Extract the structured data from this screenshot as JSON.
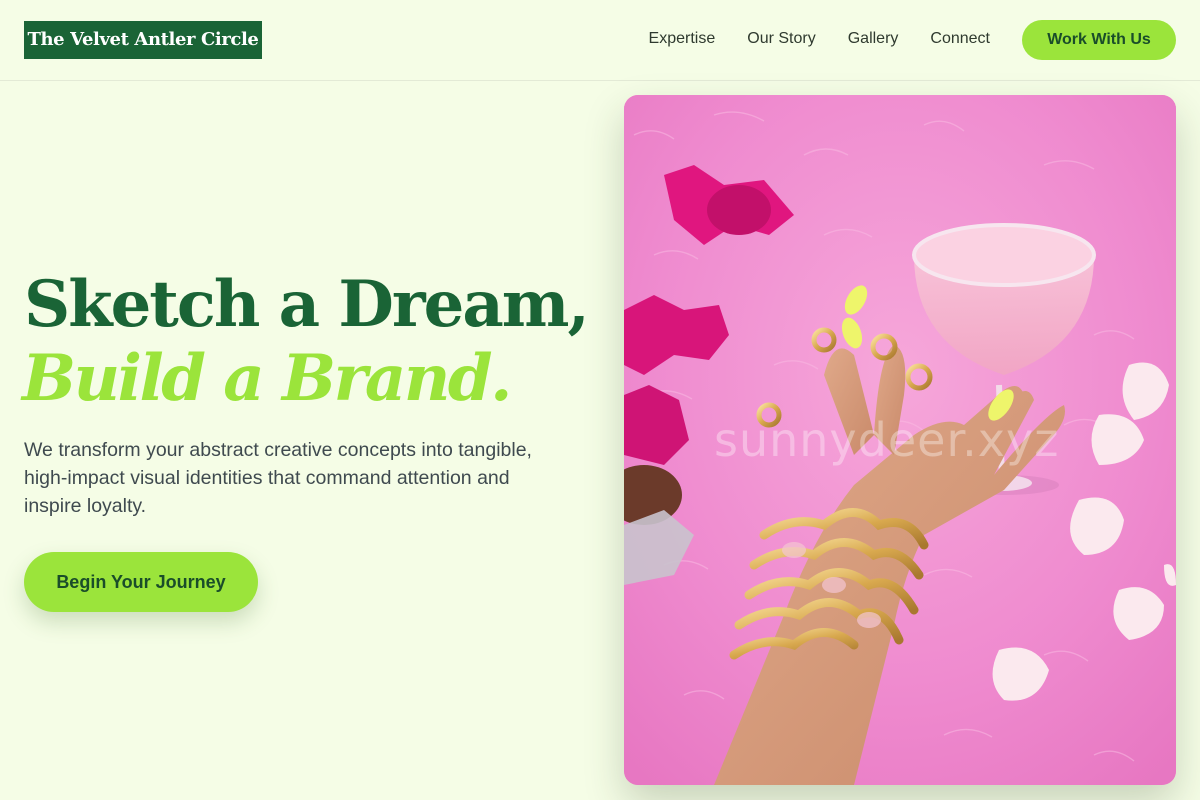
{
  "header": {
    "brand": "The Velvet Antler Circle",
    "nav": [
      "Expertise",
      "Our Story",
      "Gallery",
      "Connect"
    ],
    "cta_label": "Work With Us"
  },
  "hero": {
    "title_line1": "Sketch a Dream,",
    "title_line2": "Build a Brand.",
    "description": "We transform your abstract creative concepts into tangible, high-impact visual identities that command attention and inspire loyalty.",
    "cta_label": "Begin Your Journey",
    "image_watermark": "sunnydeer.xyz"
  },
  "colors": {
    "background": "#f5fde6",
    "brand_green": "#1a6436",
    "accent_lime": "#9be43b",
    "image_pink": "#ef8bcf"
  }
}
